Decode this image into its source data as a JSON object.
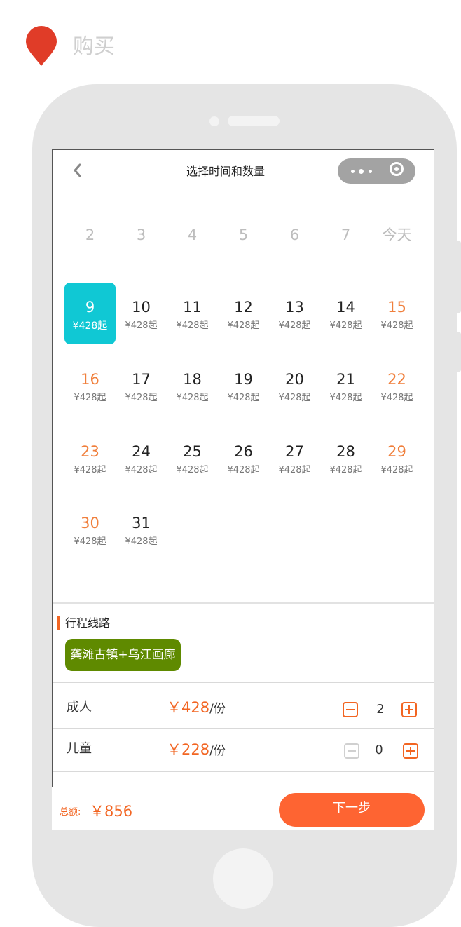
{
  "header": {
    "label": "购买",
    "pin_color": "#e03c28"
  },
  "nav": {
    "title": "选择时间和数量",
    "back_icon": "chevron-left-icon",
    "capsule_icons": [
      "more-dots-icon",
      "close-circle-icon"
    ]
  },
  "calendar": {
    "weekdays": [
      "2",
      "3",
      "4",
      "5",
      "6",
      "7",
      "今天"
    ],
    "selected_color": "#10c8d4",
    "weekend_color": "#f07f3c",
    "days": [
      {
        "day": "9",
        "price": "¥428起",
        "selected": true
      },
      {
        "day": "10",
        "price": "¥428起"
      },
      {
        "day": "11",
        "price": "¥428起"
      },
      {
        "day": "12",
        "price": "¥428起"
      },
      {
        "day": "13",
        "price": "¥428起"
      },
      {
        "day": "14",
        "price": "¥428起"
      },
      {
        "day": "15",
        "price": "¥428起",
        "weekend": true
      },
      {
        "day": "16",
        "price": "¥428起",
        "weekend": true
      },
      {
        "day": "17",
        "price": "¥428起"
      },
      {
        "day": "18",
        "price": "¥428起"
      },
      {
        "day": "19",
        "price": "¥428起"
      },
      {
        "day": "20",
        "price": "¥428起"
      },
      {
        "day": "21",
        "price": "¥428起"
      },
      {
        "day": "22",
        "price": "¥428起",
        "weekend": true
      },
      {
        "day": "23",
        "price": "¥428起",
        "weekend": true
      },
      {
        "day": "24",
        "price": "¥428起"
      },
      {
        "day": "25",
        "price": "¥428起"
      },
      {
        "day": "26",
        "price": "¥428起"
      },
      {
        "day": "27",
        "price": "¥428起"
      },
      {
        "day": "28",
        "price": "¥428起"
      },
      {
        "day": "29",
        "price": "¥428起",
        "weekend": true
      },
      {
        "day": "30",
        "price": "¥428起",
        "weekend": true
      },
      {
        "day": "31",
        "price": "¥428起"
      }
    ]
  },
  "route": {
    "title": "行程线路",
    "tag": "龚滩古镇+乌江画廊",
    "tag_color": "#5f8a00"
  },
  "tickets": [
    {
      "label": "成人",
      "currency": "￥",
      "price": "428",
      "unit": "/份",
      "quantity": "2",
      "minus_enabled": true
    },
    {
      "label": "儿童",
      "currency": "￥",
      "price": "228",
      "unit": "/份",
      "quantity": "0",
      "minus_enabled": false
    }
  ],
  "footer": {
    "total_label": "总额:",
    "total_value": "￥856",
    "next_label": "下一步",
    "accent": "#fe6432"
  }
}
